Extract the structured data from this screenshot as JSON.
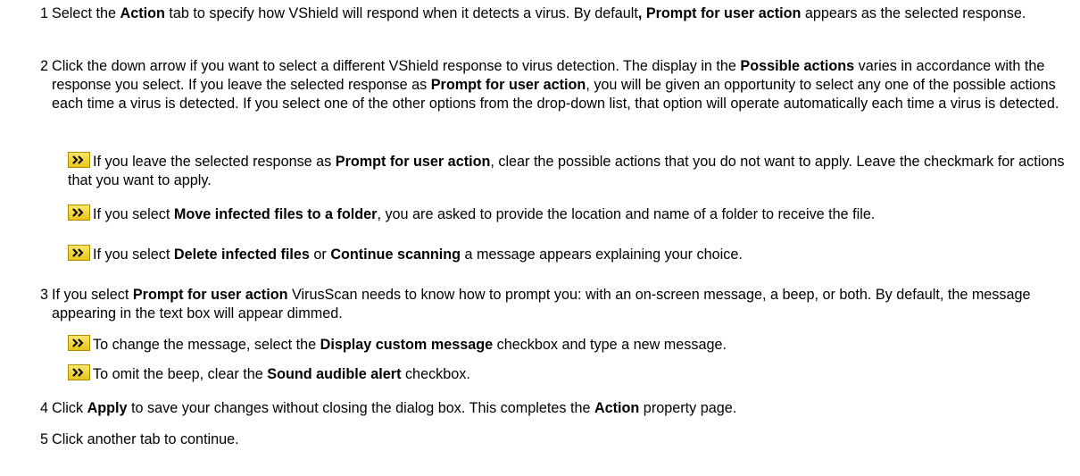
{
  "steps": [
    {
      "num": "1",
      "parts": [
        [
          "t",
          "Select the "
        ],
        [
          "b",
          "Action"
        ],
        [
          "t",
          " tab to specify how VShield will respond when it detects a virus. By default"
        ],
        [
          "b",
          ", Prompt for user action"
        ],
        [
          "t",
          " appears as the selected response."
        ]
      ]
    },
    {
      "num": "2",
      "parts": [
        [
          "t",
          "Click the down arrow if you want to select a different VShield response to virus detection. The display in the "
        ],
        [
          "b",
          "Possible actions"
        ],
        [
          "t",
          " varies in accordance with the response you select. If you leave the selected response as "
        ],
        [
          "b",
          "Prompt for user action"
        ],
        [
          "t",
          ", you will be given an opportunity to select any one of the possible actions each time a virus is detected. If you select one of the other options from the drop-down list, that option will operate automatically each time a virus is detected."
        ]
      ]
    },
    {
      "num": "3",
      "parts": [
        [
          "t",
          "If you select "
        ],
        [
          "b",
          "Prompt for user action"
        ],
        [
          "t",
          " VirusScan needs to know how to prompt you: with an on-screen message, a beep, or both. By default, the message appearing in the text box will appear dimmed."
        ]
      ]
    },
    {
      "num": "4",
      "parts": [
        [
          "t",
          "Click "
        ],
        [
          "b",
          "Apply"
        ],
        [
          "t",
          " to save your changes without closing the dialog box. This completes the "
        ],
        [
          "b",
          "Action"
        ],
        [
          "t",
          " property page."
        ]
      ]
    },
    {
      "num": "5",
      "parts": [
        [
          "t",
          "Click another tab to continue."
        ]
      ]
    }
  ],
  "subs": [
    {
      "icon": "chevron-right-icon",
      "parts": [
        [
          "t",
          "If you leave the selected response as "
        ],
        [
          "b",
          "Prompt for user action"
        ],
        [
          "t",
          ", clear the possible actions that you do not want to apply. Leave the checkmark for actions that you want to apply."
        ]
      ]
    },
    {
      "icon": "chevron-right-icon",
      "parts": [
        [
          "t",
          "If you select "
        ],
        [
          "b",
          "Move infected files to a folder"
        ],
        [
          "t",
          ", you are asked to provide the location and name of a folder to receive the file."
        ]
      ]
    },
    {
      "icon": "chevron-right-icon",
      "parts": [
        [
          "t",
          "If you select "
        ],
        [
          "b",
          "Delete infected files"
        ],
        [
          "t",
          "  or "
        ],
        [
          "b",
          "Continue scanning"
        ],
        [
          "t",
          " a message appears explaining your choice."
        ]
      ]
    },
    {
      "icon": "chevron-right-icon",
      "parts": [
        [
          "t",
          "To change the message, select the "
        ],
        [
          "b",
          "Display custom message"
        ],
        [
          "t",
          " checkbox and type a new message."
        ]
      ]
    },
    {
      "icon": "chevron-right-icon",
      "parts": [
        [
          "t",
          "To omit the beep, clear the "
        ],
        [
          "b",
          "Sound audible alert"
        ],
        [
          "t",
          " checkbox."
        ]
      ]
    }
  ]
}
